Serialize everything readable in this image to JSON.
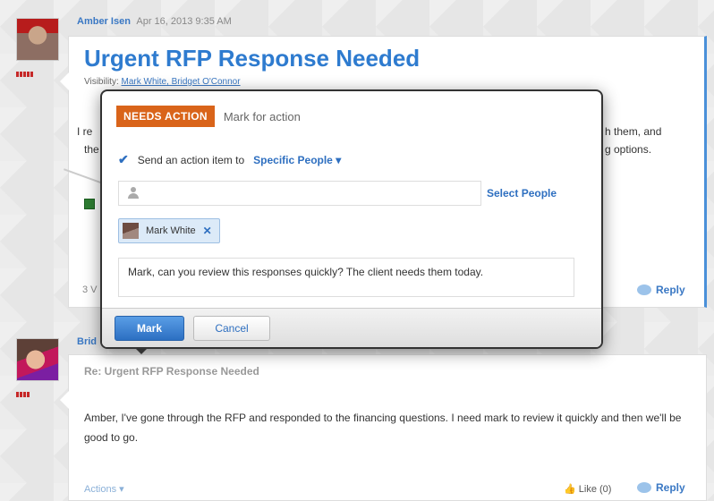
{
  "post1": {
    "author": "Amber Isen",
    "timestamp": "Apr 16, 2013 9:35 AM",
    "title": "Urgent RFP Response Needed",
    "visibility_label": "Visibility:",
    "visibility_people": "Mark White, Bridget O'Connor",
    "frag_left_1": "I re",
    "frag_left_2": "the",
    "frag_right_1": "h them, and",
    "frag_right_2": "g options.",
    "count_frag": "3 V",
    "reply_label": "Reply"
  },
  "post2": {
    "author": "Brid",
    "title": "Re: Urgent RFP Response Needed",
    "body": "Amber, I've gone through the RFP and responded to the financing questions. I need mark to review it quickly and then we'll be good to go.",
    "actions_label": "Actions",
    "like_label": "Like (0)",
    "reply_label": "Reply"
  },
  "dialog": {
    "badge": "NEEDS ACTION",
    "heading": "Mark for action",
    "send_prefix": "Send an action item to",
    "send_target": "Specific People",
    "people_placeholder": "",
    "select_people": "Select People",
    "chip_name": "Mark White",
    "message": "Mark, can you review this responses quickly? The client needs them today.",
    "mark_button": "Mark",
    "cancel_button": "Cancel"
  },
  "colors": {
    "badge": "#d9641a",
    "link": "#2e6fc0",
    "title": "#2e7bcf"
  }
}
